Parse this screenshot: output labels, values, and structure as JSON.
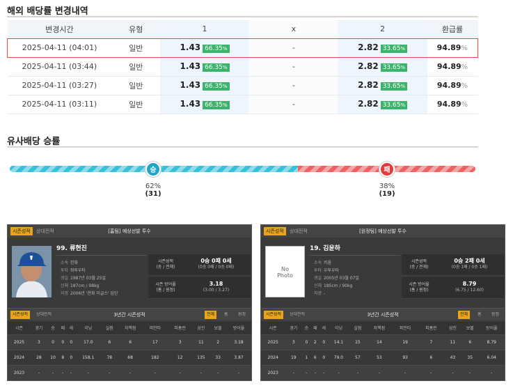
{
  "odds_section": {
    "title": "해외 배당률 변경내역",
    "headers": [
      "변경시간",
      "유형",
      "1",
      "x",
      "2",
      "환급률"
    ],
    "rows": [
      {
        "time": "2025-04-11 (04:01)",
        "type": "일반",
        "odd1": "1.43",
        "pct1": "66.35",
        "x": "-",
        "odd2": "2.82",
        "pct2": "33.65",
        "rate": "94.89",
        "highlighted": true
      },
      {
        "time": "2025-04-11 (03:44)",
        "type": "일반",
        "odd1": "1.43",
        "pct1": "66.35",
        "x": "-",
        "odd2": "2.82",
        "pct2": "33.65",
        "rate": "94.89"
      },
      {
        "time": "2025-04-11 (03:27)",
        "type": "일반",
        "odd1": "1.43",
        "pct1": "66.35",
        "x": "-",
        "odd2": "2.82",
        "pct2": "33.65",
        "rate": "94.89"
      },
      {
        "time": "2025-04-11 (03:11)",
        "type": "일반",
        "odd1": "1.43",
        "pct1": "66.35",
        "x": "-",
        "odd2": "2.82",
        "pct2": "33.65",
        "rate": "94.89"
      }
    ],
    "pct_symbol": "%",
    "pct_color": "#3bb36b",
    "highlight_color": "#e24b4b"
  },
  "similar_section": {
    "title": "유사배당 승률",
    "win_label": "승",
    "lose_label": "패",
    "win_pct": "62%",
    "win_count": "(31)",
    "lose_pct": "38%",
    "lose_count": "(19)",
    "win_fraction": 0.62,
    "win_color": "#1fa6c9",
    "lose_color": "#e33b3b"
  },
  "pitchers": [
    {
      "tab_active": "시즌성적",
      "tab_other": "상대전적",
      "title": "[홈팀] 예상선발 투수",
      "name": "99. 류현진",
      "has_photo": true,
      "info": [
        {
          "k": "소속",
          "v": "한화"
        },
        {
          "k": "투타",
          "v": "좌투우타"
        },
        {
          "k": "생일",
          "v": "1987년 03월 25일"
        },
        {
          "k": "신체",
          "v": "187cm / 98kg"
        },
        {
          "k": "지명",
          "v": "2006년 '한화 이글스' 입단"
        }
      ],
      "record_key": "시즌성적\n(승 / 전체)",
      "record_val": "0승 0패 0세",
      "record_sub": "(0승 0패 / 0승 0패)",
      "era_key": "시즌 방어율\n(홈 / 원정)",
      "era_val": "3.18",
      "era_sub": "(3.00 / 3.27)",
      "table_title": "3년간 시즌성적",
      "table_tabs": [
        "전체",
        "홈",
        "원정"
      ],
      "columns": [
        "시즌",
        "경기",
        "승",
        "패",
        "세",
        "이닝",
        "실점",
        "자책점",
        "피안타",
        "피홈런",
        "삼진",
        "보볼",
        "방어율"
      ],
      "rows": [
        [
          "2025",
          "3",
          "0",
          "0",
          "0",
          "17.0",
          "6",
          "6",
          "17",
          "3",
          "11",
          "2",
          "3.18"
        ],
        [
          "2024",
          "28",
          "10",
          "8",
          "0",
          "158.1",
          "78",
          "68",
          "182",
          "12",
          "135",
          "33",
          "3.87"
        ],
        [
          "2023",
          "-",
          "-",
          "-",
          "-",
          "-",
          "-",
          "-",
          "-",
          "-",
          "-",
          "-",
          "-"
        ]
      ]
    },
    {
      "tab_active": "시즌성적",
      "tab_other": "상대전적",
      "title": "[원정팀] 예상선발 투수",
      "name": "19. 김윤하",
      "has_photo": false,
      "no_photo_text": "No\nPhoto",
      "info": [
        {
          "k": "소속",
          "v": "키움"
        },
        {
          "k": "투타",
          "v": "우투우타"
        },
        {
          "k": "생일",
          "v": "2005년 03월 07일"
        },
        {
          "k": "신체",
          "v": "185cm / 90kg"
        },
        {
          "k": "지명",
          "v": "-"
        }
      ],
      "record_key": "시즌성적\n(승 / 전체)",
      "record_val": "0승 2패 0세",
      "record_sub": "(0승 1패 / 0승 1패)",
      "era_key": "시즌 방어율\n(홈 / 원정)",
      "era_val": "8.79",
      "era_sub": "(6.75 / 12.60)",
      "table_title": "3년간 시즌성적",
      "table_tabs": [
        "전체",
        "홈",
        "원정"
      ],
      "columns": [
        "시즌",
        "경기",
        "승",
        "패",
        "세",
        "이닝",
        "실점",
        "자책점",
        "피안타",
        "피홈런",
        "삼진",
        "보볼",
        "방어율"
      ],
      "rows": [
        [
          "2025",
          "3",
          "0",
          "2",
          "0",
          "14.1",
          "15",
          "14",
          "19",
          "7",
          "11",
          "6",
          "8.79"
        ],
        [
          "2024",
          "19",
          "1",
          "6",
          "0",
          "79.0",
          "57",
          "53",
          "93",
          "6",
          "43",
          "35",
          "6.04"
        ],
        [
          "2023",
          "-",
          "-",
          "-",
          "-",
          "-",
          "-",
          "-",
          "-",
          "-",
          "-",
          "-",
          "-"
        ]
      ]
    }
  ]
}
